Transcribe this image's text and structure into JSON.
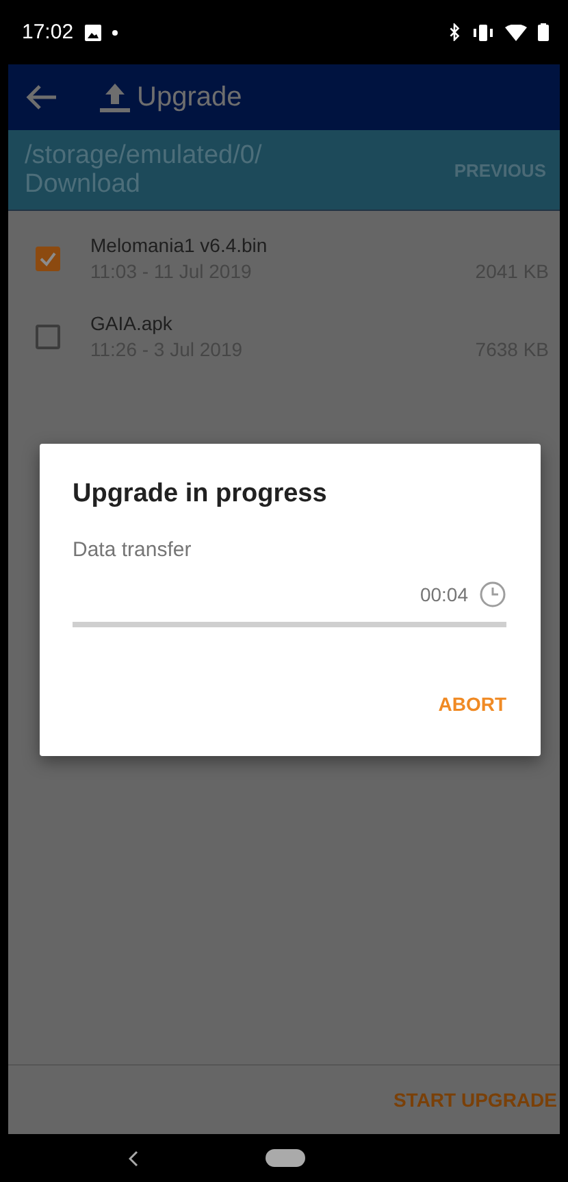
{
  "status_bar": {
    "time": "17:02"
  },
  "app_bar": {
    "title": "Upgrade"
  },
  "path_bar": {
    "path": "/storage/emulated/0/\nDownload",
    "button": "PREVIOUS"
  },
  "files": [
    {
      "name": "Melomania1 v6.4.bin",
      "date": "11:03 - 11 Jul 2019",
      "size": "2041 KB",
      "checked": true
    },
    {
      "name": "GAIA.apk",
      "date": "11:26 - 3 Jul 2019",
      "size": "7638 KB",
      "checked": false
    }
  ],
  "dialog": {
    "title": "Upgrade in progress",
    "label": "Data transfer",
    "elapsed": "00:04",
    "level": 0,
    "button": "ABORT"
  },
  "footer": {
    "button": "START UPGRADE"
  }
}
